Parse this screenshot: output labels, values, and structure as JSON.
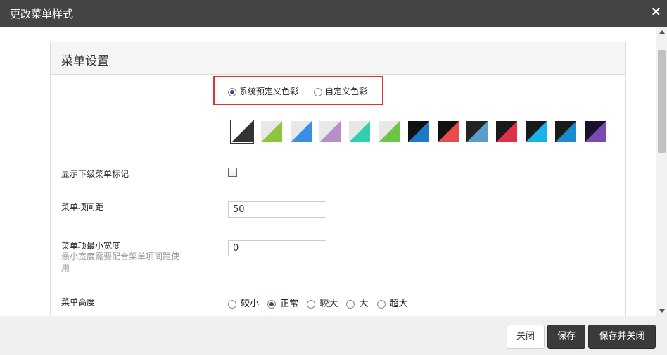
{
  "window": {
    "title": "更改菜单样式",
    "close_icon": "×"
  },
  "panel": {
    "title": "菜单设置"
  },
  "color_mode": {
    "options": [
      {
        "label": "系统预定义色彩",
        "checked": true
      },
      {
        "label": "自定义色彩",
        "checked": false
      }
    ]
  },
  "swatches": [
    {
      "top": "#ffffff",
      "bottom": "#333333",
      "selected": true
    },
    {
      "top": "#e8e8e8",
      "bottom": "#8cc63e",
      "selected": false
    },
    {
      "top": "#e8e8e8",
      "bottom": "#3a8ee6",
      "selected": false
    },
    {
      "top": "#e8e8e8",
      "bottom": "#b68fc8",
      "selected": false
    },
    {
      "top": "#e8e8e8",
      "bottom": "#2fcfb0",
      "selected": false
    },
    {
      "top": "#e8e8e8",
      "bottom": "#6cc644",
      "selected": false
    },
    {
      "top": "#111111",
      "bottom": "#1e78c8",
      "selected": false
    },
    {
      "top": "#111111",
      "bottom": "#e84b4b",
      "selected": false
    },
    {
      "top": "#222222",
      "bottom": "#5a9ec8",
      "selected": false
    },
    {
      "top": "#1a1a1a",
      "bottom": "#e0304a",
      "selected": false
    },
    {
      "top": "#1a1a1a",
      "bottom": "#18b4e8",
      "selected": false
    },
    {
      "top": "#1a1a1a",
      "bottom": "#1a8acc",
      "selected": false
    },
    {
      "top": "#1a1030",
      "bottom": "#7a4ab0",
      "selected": false
    }
  ],
  "settings": {
    "show_submenu_marker": {
      "label": "显示下级菜单标记",
      "checked": false
    },
    "item_spacing": {
      "label": "菜单项间距",
      "value": "50"
    },
    "item_min_width": {
      "label": "菜单项最小宽度",
      "hint": "最小宽度需要配合菜单项间距使用",
      "value": "0"
    },
    "menu_height": {
      "label": "菜单高度",
      "options": [
        {
          "label": "较小",
          "checked": false
        },
        {
          "label": "正常",
          "checked": true
        },
        {
          "label": "较大",
          "checked": false
        },
        {
          "label": "大",
          "checked": false
        },
        {
          "label": "超大",
          "checked": false
        }
      ]
    }
  },
  "footer": {
    "close_label": "关闭",
    "save_label": "保存",
    "save_close_label": "保存并关闭"
  }
}
